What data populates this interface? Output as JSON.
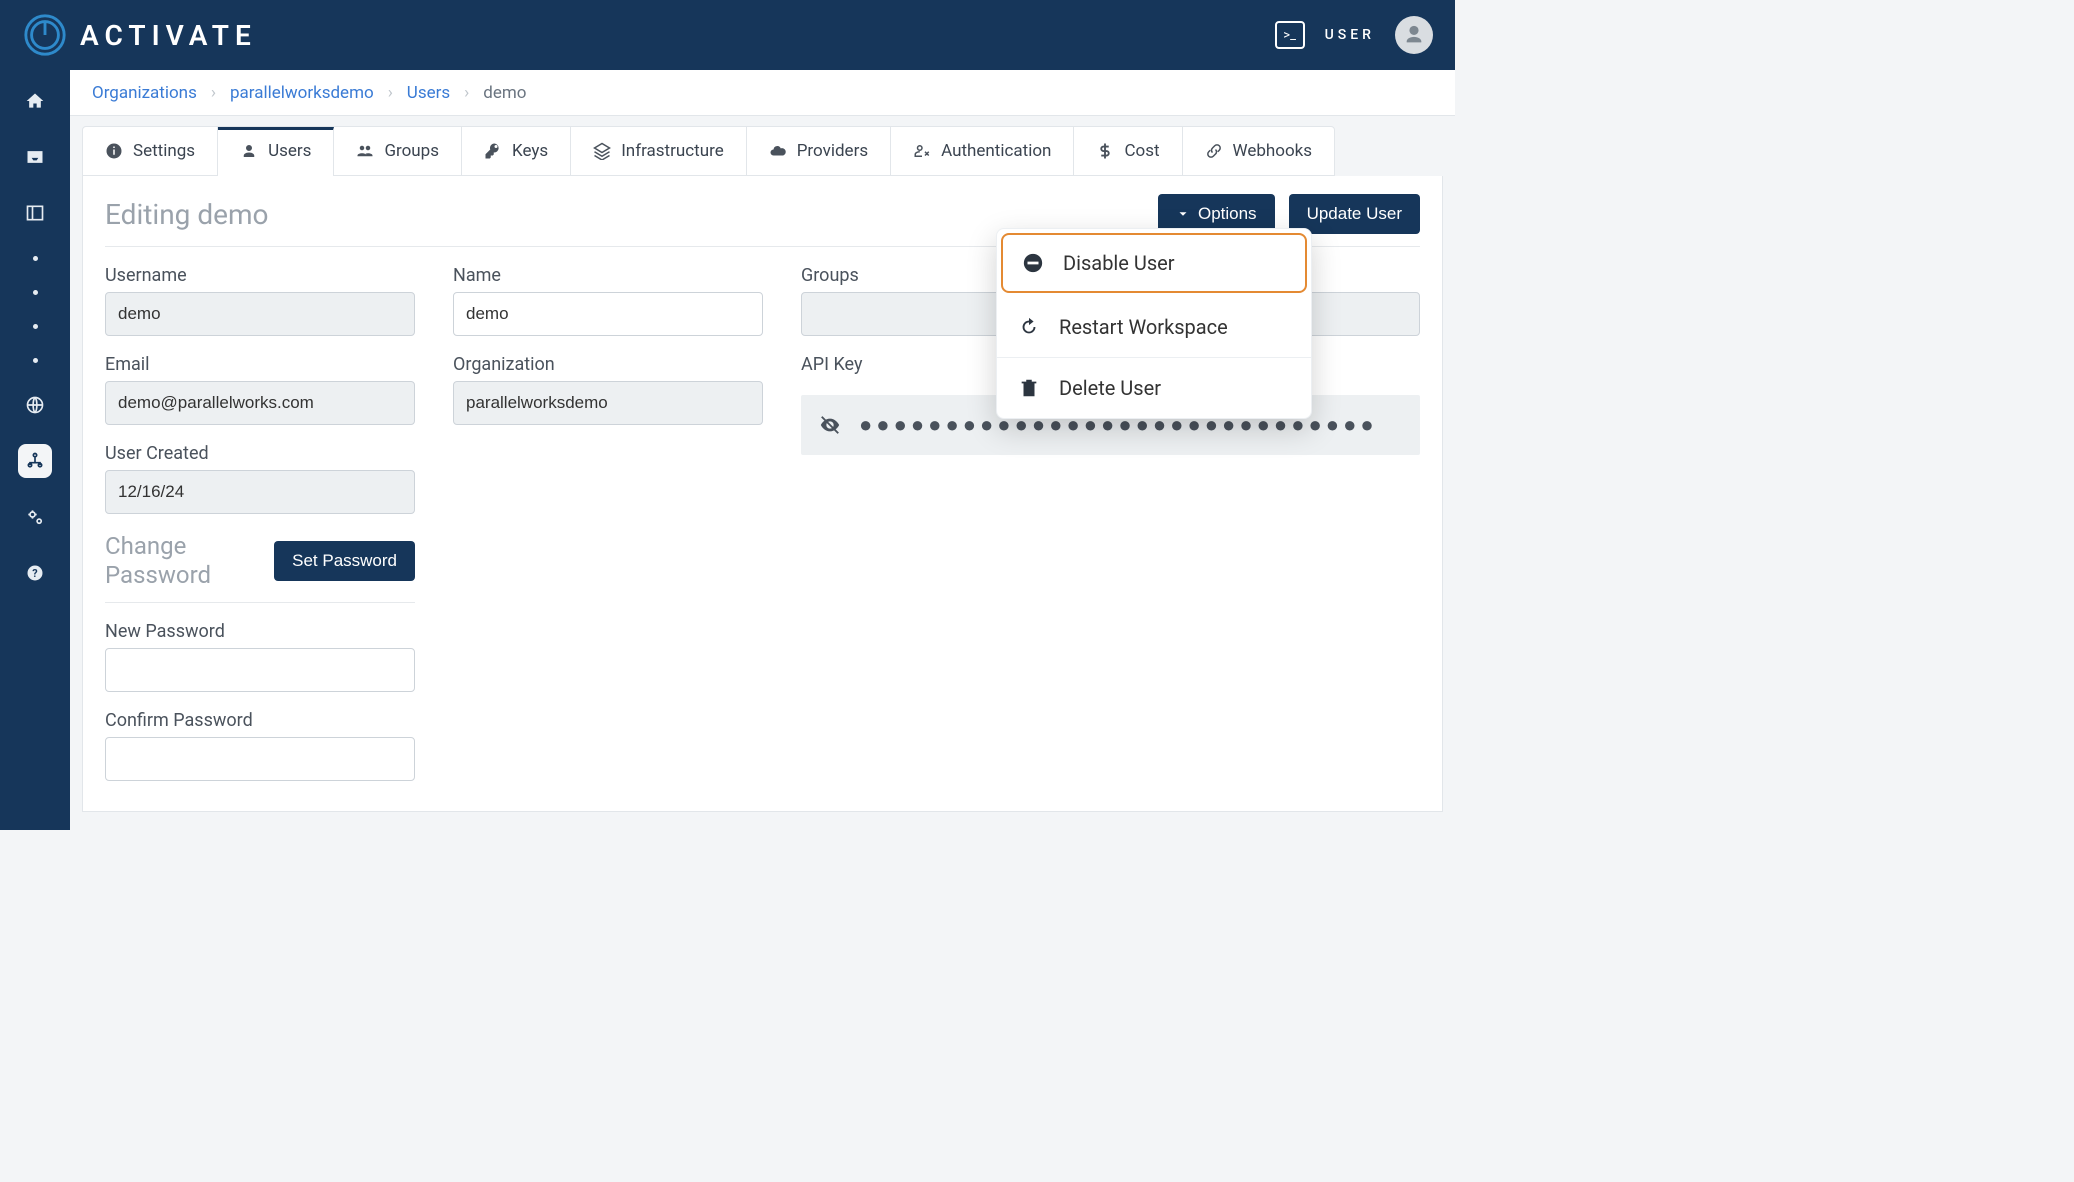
{
  "brand": {
    "name": "ACTIVATE"
  },
  "header": {
    "user_label": "USER"
  },
  "breadcrumb": {
    "items": [
      "Organizations",
      "parallelworksdemo",
      "Users",
      "demo"
    ]
  },
  "tabs": {
    "settings": "Settings",
    "users": "Users",
    "groups": "Groups",
    "keys": "Keys",
    "infrastructure": "Infrastructure",
    "providers": "Providers",
    "authentication": "Authentication",
    "cost": "Cost",
    "webhooks": "Webhooks"
  },
  "panel": {
    "title": "Editing demo",
    "options_label": "Options",
    "update_label": "Update User"
  },
  "options_menu": {
    "disable": "Disable User",
    "restart": "Restart Workspace",
    "delete": "Delete User"
  },
  "fields": {
    "username_label": "Username",
    "username_value": "demo",
    "name_label": "Name",
    "name_value": "demo",
    "email_label": "Email",
    "email_value": "demo@parallelworks.com",
    "org_label": "Organization",
    "org_value": "parallelworksdemo",
    "created_label": "User Created",
    "created_value": "12/16/24",
    "groups_label": "Groups",
    "api_key_label": "API Key",
    "api_key_masked": "●●●●●●●●●●●●●●●●●●●●●●●●●●●●●●"
  },
  "password": {
    "section_title": "Change\nPassword",
    "set_button": "Set Password",
    "new_label": "New Password",
    "confirm_label": "Confirm Password"
  }
}
